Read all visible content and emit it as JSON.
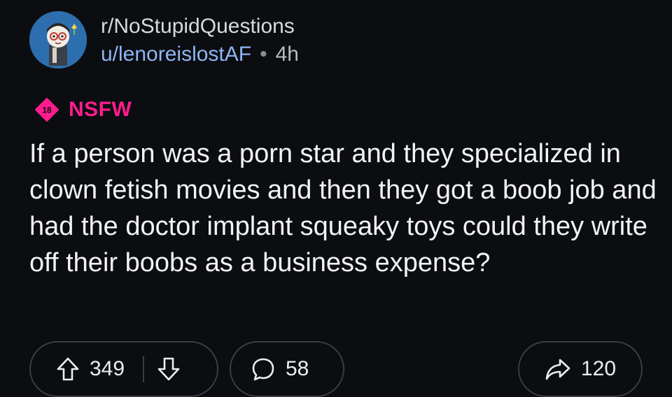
{
  "post": {
    "subreddit": "r/NoStupidQuestions",
    "author": "u/lenoreislostAF",
    "separator": "•",
    "age": "4h",
    "nsfw_badge": "18",
    "nsfw_label": "NSFW",
    "title": "If a person was a porn star and they specialized in clown fetish movies and then they got a boob job and had the doctor implant squeaky toys could they write off their boobs as a business expense?"
  },
  "actions": {
    "upvotes": "349",
    "comments": "58",
    "shares": "120"
  },
  "icons": {
    "upvote": "arrow-up-icon",
    "downvote": "arrow-down-icon",
    "comment": "speech-bubble-icon",
    "share": "share-arrow-icon"
  },
  "colors": {
    "background": "#0b0d10",
    "author": "#8fb5f5",
    "nsfw": "#ff1c8f",
    "avatar_bg": "#2d6fae"
  }
}
